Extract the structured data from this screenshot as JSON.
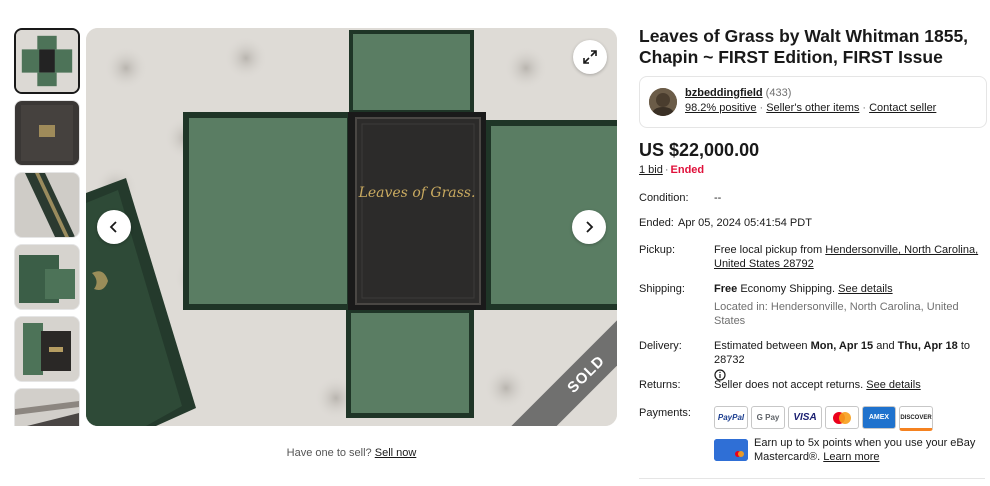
{
  "listing": {
    "title": "Leaves of Grass by Walt Whitman 1855, Chapin ~ FIRST Edition, FIRST Issue",
    "sold_banner": "SOLD",
    "book_spine_text": "Leaves of Grass.",
    "price": "US $22,000.00",
    "bids": "1 bid",
    "bid_separator": "·",
    "status": "Ended"
  },
  "seller": {
    "name": "bzbeddingfield",
    "feedback_count": "(433)",
    "positive": "98.2% positive",
    "other_items": "Seller's other items",
    "contact": "Contact seller",
    "separator": "·"
  },
  "gallery": {
    "thumbnail_count": 6,
    "selected_index": 0,
    "sell_prompt": "Have one to sell?",
    "sell_link": "Sell now"
  },
  "details": {
    "condition_label": "Condition:",
    "condition_value": "--",
    "ended_label": "Ended:",
    "ended_value": "Apr 05, 2024 05:41:54 PDT",
    "pickup_label": "Pickup:",
    "pickup_prefix": "Free local pickup from",
    "pickup_location": "Hendersonville, North Carolina, United States 28792",
    "shipping_label": "Shipping:",
    "shipping_free": "Free",
    "shipping_method": "Economy Shipping.",
    "shipping_link": "See details",
    "located_in": "Located in: Hendersonville, North Carolina, United States",
    "delivery_label": "Delivery:",
    "delivery_prefix": "Estimated between",
    "delivery_start": "Mon, Apr 15",
    "delivery_and": "and",
    "delivery_end": "Thu, Apr 18",
    "delivery_to": "to 28732",
    "returns_label": "Returns:",
    "returns_value": "Seller does not accept returns.",
    "returns_link": "See details",
    "payments_label": "Payments:",
    "payment_methods": [
      "PayPal",
      "G Pay",
      "VISA",
      "Mastercard",
      "AMEX",
      "DISCOVER"
    ],
    "ebay_card_text": "Earn up to 5x points when you use your eBay Mastercard®.",
    "ebay_card_link": "Learn more"
  },
  "colors": {
    "accent_red": "#e0103a",
    "text": "#191919",
    "muted": "#707070",
    "border": "#e5e5e5",
    "book_green": "#3f6b4e"
  }
}
